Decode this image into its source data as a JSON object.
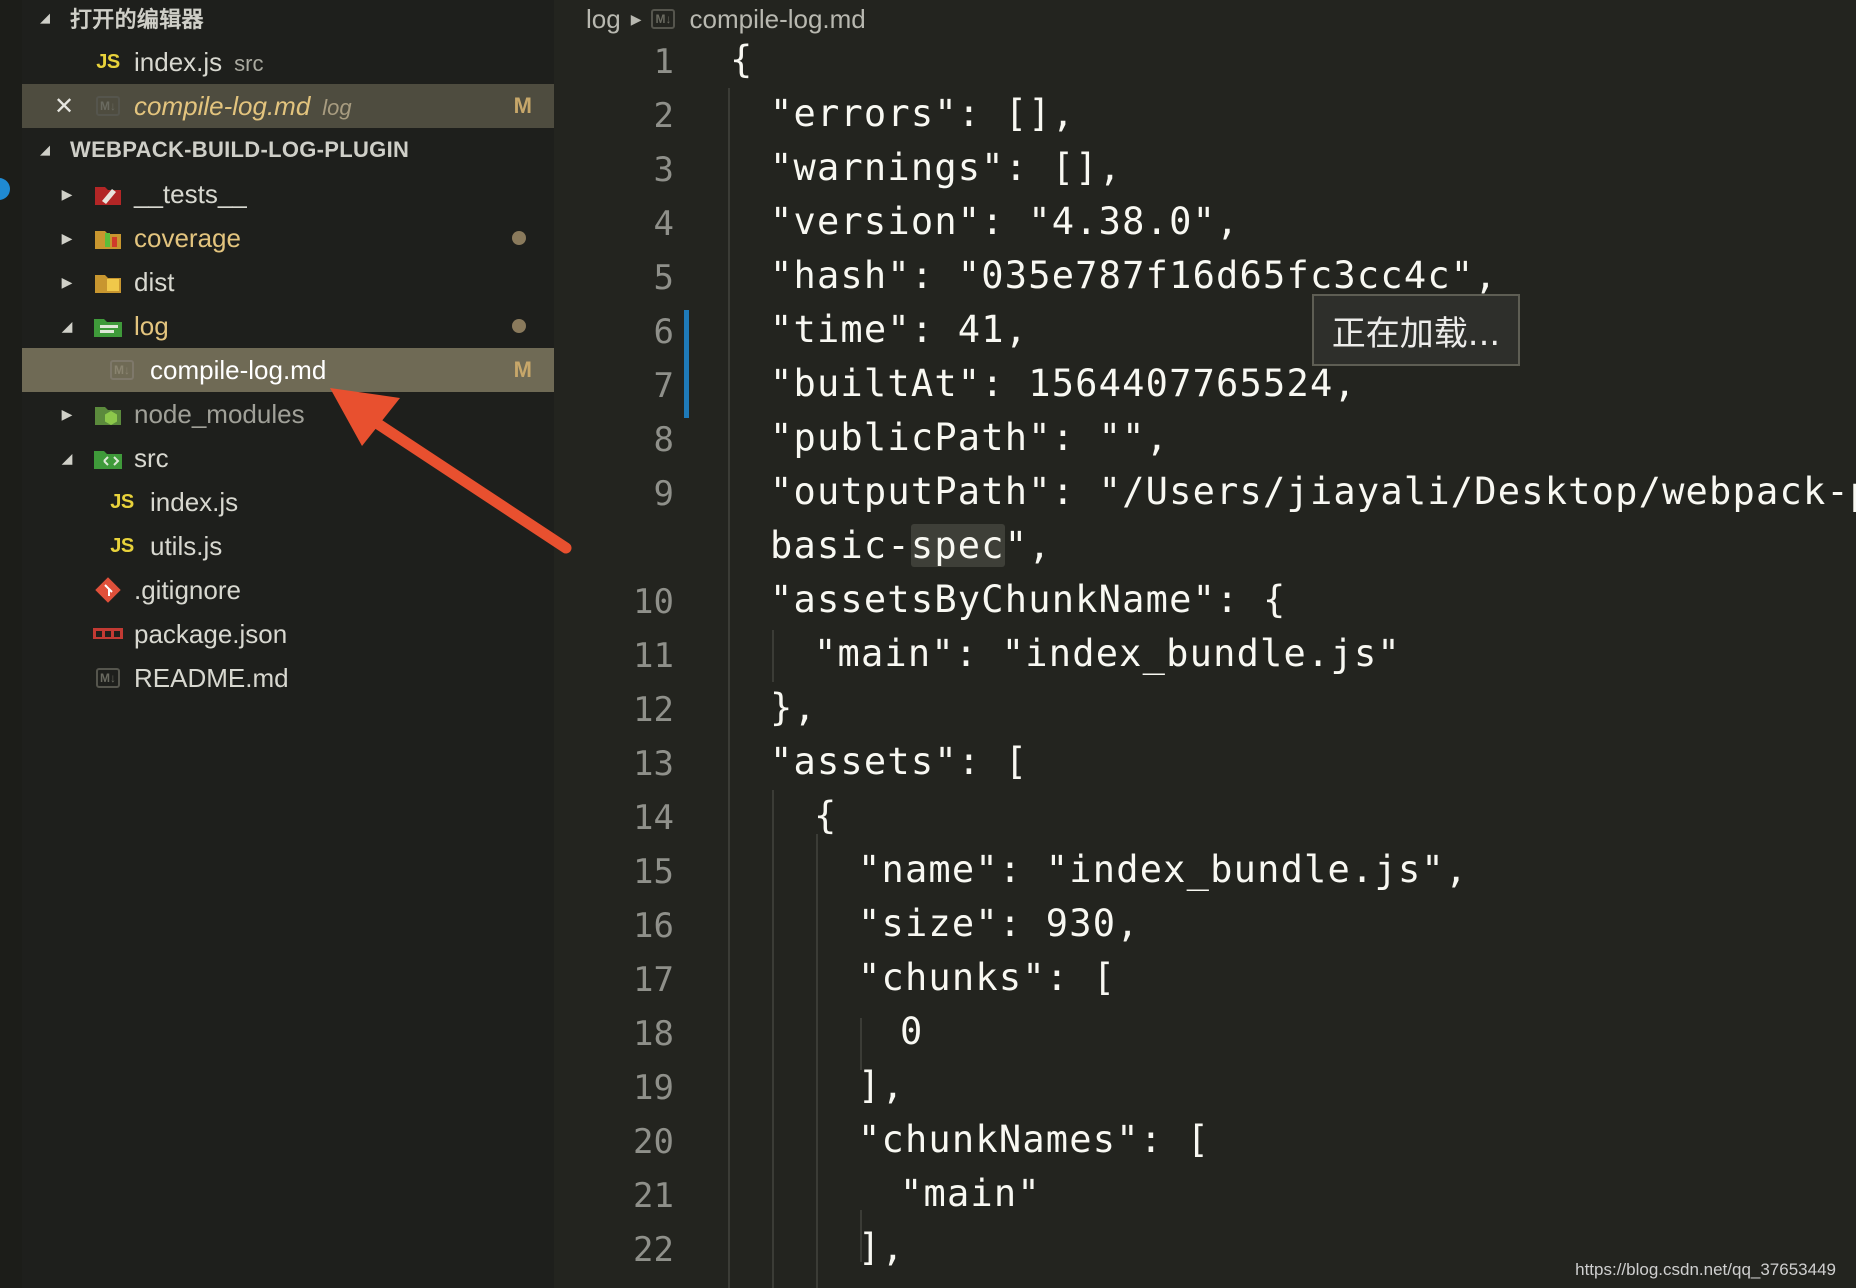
{
  "sidebar": {
    "open_editors": {
      "title": "打开的编辑器",
      "items": [
        {
          "name": "index.js",
          "desc": "src",
          "icon": "js-file-icon"
        },
        {
          "name": "compile-log.md",
          "desc": "log",
          "badge": "M",
          "icon": "markdown-file-icon"
        }
      ]
    },
    "project": {
      "title": "WEBPACK-BUILD-LOG-PLUGIN",
      "items": [
        {
          "name": "__tests__",
          "type": "folder",
          "icon": "tests-folder-icon"
        },
        {
          "name": "coverage",
          "type": "folder",
          "icon": "coverage-folder-icon"
        },
        {
          "name": "dist",
          "type": "folder",
          "icon": "dist-folder-icon"
        },
        {
          "name": "log",
          "type": "folder",
          "icon": "log-folder-icon"
        },
        {
          "name": "compile-log.md",
          "type": "file",
          "badge": "M",
          "icon": "markdown-file-icon"
        },
        {
          "name": "node_modules",
          "type": "folder",
          "icon": "node-modules-folder-icon"
        },
        {
          "name": "src",
          "type": "folder",
          "icon": "src-folder-icon"
        },
        {
          "name": "index.js",
          "type": "file",
          "icon": "js-file-icon"
        },
        {
          "name": "utils.js",
          "type": "file",
          "icon": "js-file-icon"
        },
        {
          "name": ".gitignore",
          "type": "file",
          "icon": "git-file-icon"
        },
        {
          "name": "package.json",
          "type": "file",
          "icon": "npm-file-icon"
        },
        {
          "name": "README.md",
          "type": "file",
          "icon": "markdown-file-icon"
        }
      ]
    }
  },
  "icon_labels": {
    "js": "JS",
    "md": "M↓",
    "close": "✕"
  },
  "breadcrumb": {
    "folder": "log",
    "file": "compile-log.md"
  },
  "editor": {
    "lines": [
      {
        "n": "1",
        "text": "{"
      },
      {
        "n": "2",
        "text": "\"errors\": [],"
      },
      {
        "n": "3",
        "text": "\"warnings\": [],"
      },
      {
        "n": "4",
        "text": "\"version\": \"4.38.0\","
      },
      {
        "n": "5",
        "text": "\"hash\": \"035e787f16d65fc3cc4c\","
      },
      {
        "n": "6",
        "text": "\"time\": 41,"
      },
      {
        "n": "7",
        "text": "\"builtAt\": 1564407765524,"
      },
      {
        "n": "8",
        "text": "\"publicPath\": \"\","
      },
      {
        "n": "9",
        "text": "\"outputPath\": \"/Users/jiayali/Desktop/webpack-plug"
      },
      {
        "n": "",
        "text_a": "basic-",
        "text_b": "spec",
        "text_c": "\","
      },
      {
        "n": "10",
        "text": "\"assetsByChunkName\": {"
      },
      {
        "n": "11",
        "text": "\"main\": \"index_bundle.js\""
      },
      {
        "n": "12",
        "text": "},"
      },
      {
        "n": "13",
        "text": "\"assets\": ["
      },
      {
        "n": "14",
        "text": "{"
      },
      {
        "n": "15",
        "text": "\"name\": \"index_bundle.js\","
      },
      {
        "n": "16",
        "text": "\"size\": 930,"
      },
      {
        "n": "17",
        "text": "\"chunks\": ["
      },
      {
        "n": "18",
        "text": "0"
      },
      {
        "n": "19",
        "text": "],"
      },
      {
        "n": "20",
        "text": "\"chunkNames\": ["
      },
      {
        "n": "21",
        "text": "\"main\""
      },
      {
        "n": "22",
        "text": "],"
      }
    ]
  },
  "tooltip": "正在加载...",
  "watermark": "https://blog.csdn.net/qq_37653449",
  "colors": {
    "accent_arrow": "#e8502f",
    "modified": "#e3c47e",
    "change_bar": "#1f7ab8"
  }
}
